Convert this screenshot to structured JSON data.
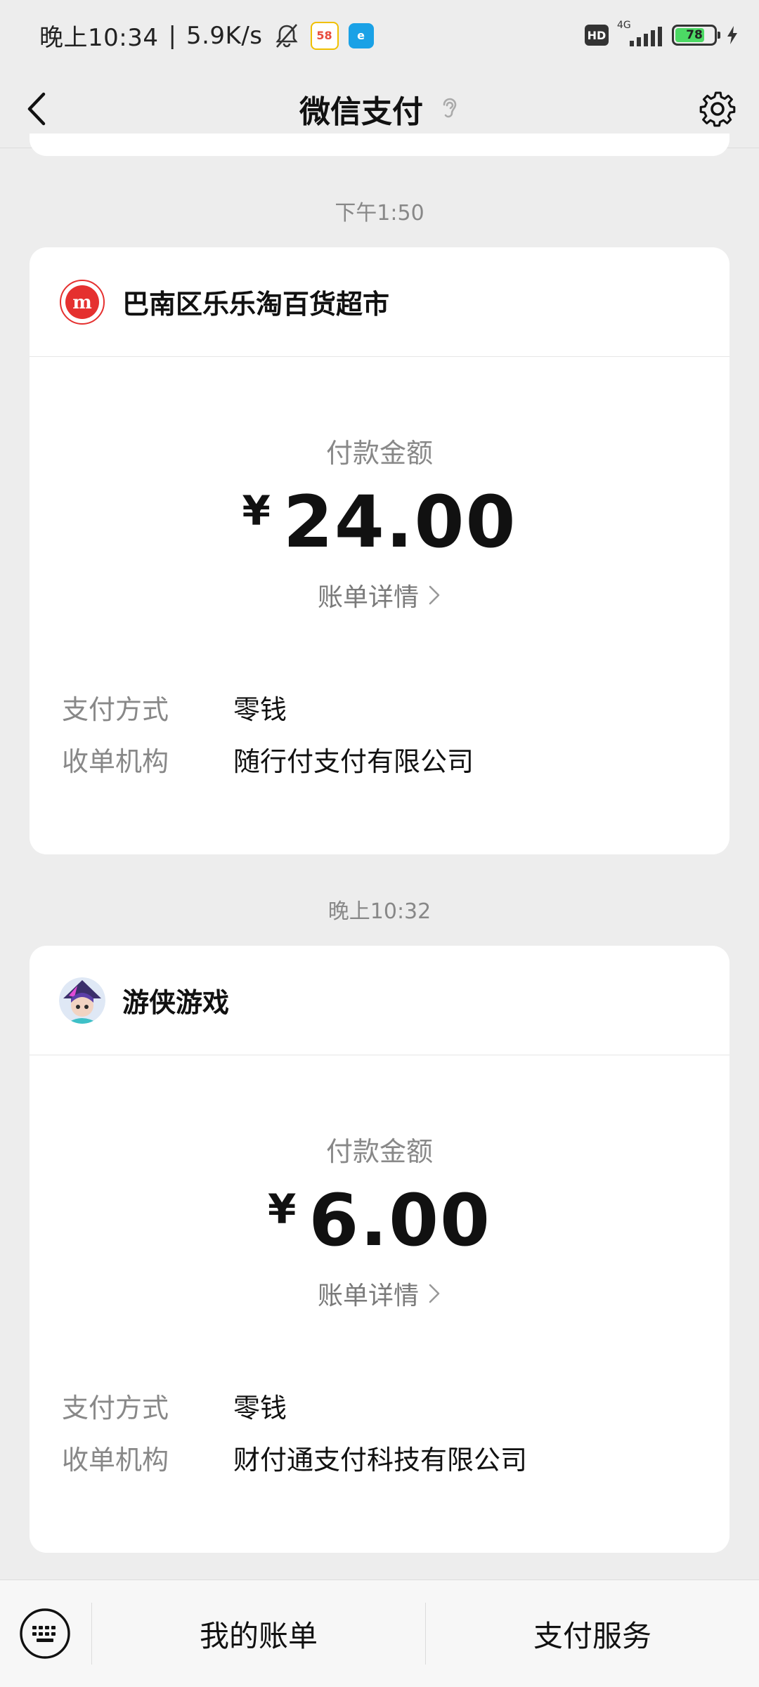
{
  "status_bar": {
    "time": "晚上10:34",
    "separator": "|",
    "speed": "5.9K/s",
    "app_badge_1": "58",
    "app_badge_2": "e",
    "hd": "HD",
    "network": "4G",
    "battery_level": "78",
    "battery_fraction": 0.78,
    "icons": [
      "bell-muted-icon",
      "58-app-icon",
      "e-app-icon",
      "hd-icon",
      "signal-icon",
      "battery-icon",
      "charging-icon"
    ]
  },
  "header": {
    "title": "微信支付",
    "icons": [
      "back-icon",
      "ear-icon",
      "gear-icon"
    ]
  },
  "messages": [
    {
      "time": "下午1:50",
      "merchant": "巴南区乐乐淘百货超市",
      "amount_label": "付款金额",
      "currency": "¥",
      "amount": "24.00",
      "detail_link": "账单详情",
      "payment_method_label": "支付方式",
      "payment_method": "零钱",
      "acquirer_label": "收单机构",
      "acquirer": "随行付支付有限公司",
      "avatar_color": "#e5302f"
    },
    {
      "time": "晚上10:32",
      "merchant": "游侠游戏",
      "amount_label": "付款金额",
      "currency": "¥",
      "amount": "6.00",
      "detail_link": "账单详情",
      "payment_method_label": "支付方式",
      "payment_method": "零钱",
      "acquirer_label": "收单机构",
      "acquirer": "财付通支付科技有限公司",
      "avatar_color": "#3a2f6b"
    }
  ],
  "bottom_bar": {
    "keyboard_icon": "keyboard-icon",
    "menu_1": "我的账单",
    "menu_2": "支付服务"
  },
  "colors": {
    "background": "#ededed",
    "card": "#ffffff",
    "muted_text": "#888888"
  }
}
